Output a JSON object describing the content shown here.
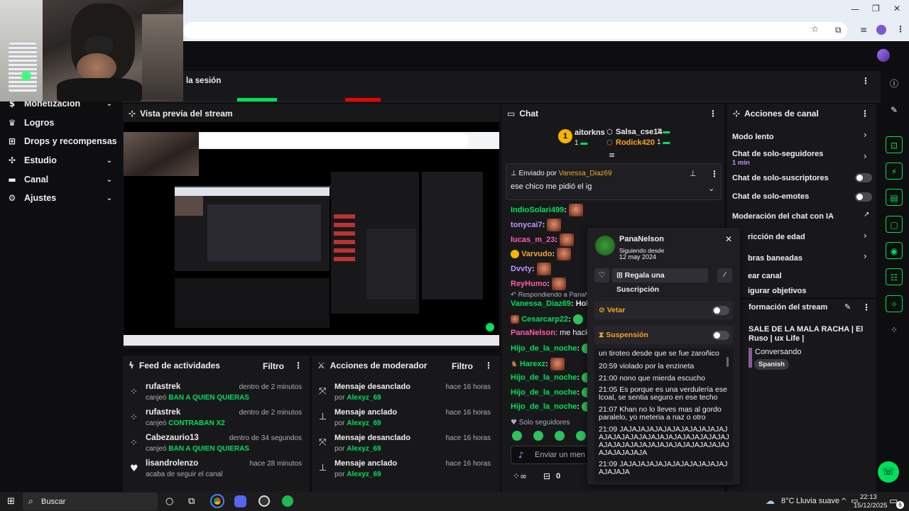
{
  "browser": {
    "minimize": "—",
    "restore": "❐",
    "close": "✕"
  },
  "stats": {
    "title_partial": "la sesión"
  },
  "sidebar": {
    "items": [
      {
        "label": "Monetización",
        "icon": "dollar-icon",
        "chevron": true
      },
      {
        "label": "Logros",
        "icon": "trophy-icon",
        "chevron": false
      },
      {
        "label": "Drops y recompensas",
        "icon": "gift-icon",
        "chevron": false
      },
      {
        "label": "Estudio",
        "icon": "studio-icon",
        "chevron": true
      },
      {
        "label": "Canal",
        "icon": "channel-icon",
        "chevron": true
      },
      {
        "label": "Ajustes",
        "icon": "gear-icon",
        "chevron": true
      }
    ]
  },
  "preview": {
    "title": "Vista previa del stream"
  },
  "activity": {
    "title": "Feed de actividades",
    "filter": "Filtro",
    "rows": [
      {
        "user": "rufastrek",
        "prefix": "canjeó",
        "reward": "BAN A QUIEN QUIERAS",
        "time": "dentro de 2 minutos"
      },
      {
        "user": "rufastrek",
        "prefix": "canjeó",
        "reward": "CONTRABAN X2",
        "time": "dentro de 2 minutos"
      },
      {
        "user": "Cabezaurio13",
        "prefix": "canjeó",
        "reward": "BAN A QUIEN QUIERAS",
        "time": "dentro de 34 segundos"
      },
      {
        "user": "lisandrolenzo",
        "prefix": "acaba de seguir el canal",
        "reward": "",
        "time": "hace 28 minutos"
      }
    ]
  },
  "modactions": {
    "title": "Acciones de moderador",
    "filter": "Filtro",
    "rows": [
      {
        "title": "Mensaje desanclado",
        "by": "por",
        "user": "Alexyz_69",
        "time": "hace 16 horas"
      },
      {
        "title": "Mensaje anclado",
        "by": "por",
        "user": "Alexyz_69",
        "time": "hace 16 horas"
      },
      {
        "title": "Mensaje desanclado",
        "by": "por",
        "user": "Alexyz_69",
        "time": "hace 16 horas"
      },
      {
        "title": "Mensaje anclado",
        "by": "por",
        "user": "Alexyz_69",
        "time": "hace 16 horas"
      }
    ]
  },
  "chat": {
    "title": "Chat",
    "leaders": [
      {
        "rank": "1",
        "name": "aitorkns",
        "count": "1"
      },
      {
        "name": "Salsa_cse14",
        "count": "1"
      },
      {
        "name": "Rodick420",
        "count": "1"
      }
    ],
    "pinned_label": "Enviado por",
    "pinned_user": "Vanessa_Diaz69",
    "pinned_text": "ese chico me pidió el ig",
    "lines": [
      {
        "name": "IndioSolari499",
        "text": ":",
        "cls": "green-name",
        "emote": "face"
      },
      {
        "name": "tonycai7",
        "text": ":",
        "cls": "purple-name",
        "emote": "face"
      },
      {
        "name": "lucas_m_23",
        "text": ":",
        "cls": "pink-name",
        "emote": "face"
      },
      {
        "name": "Varvudo",
        "text": ":",
        "cls": "green-name",
        "emote": "face"
      },
      {
        "name": "Dvvty",
        "text": ":",
        "cls": "purple-name",
        "emote": "face"
      },
      {
        "name": "ReyHumo",
        "text": ":",
        "cls": "pink-name",
        "emote": "face"
      },
      {
        "name": "Respondiendo a PanaN",
        "text": "",
        "cls": "reply",
        "emote": ""
      },
      {
        "name": "Vanessa_Diaz69",
        "text": ": Hola",
        "cls": "green-name",
        "emote": ""
      },
      {
        "name": "Cesarcarp22",
        "text": ":",
        "cls": "green-name",
        "emote": "green"
      },
      {
        "name": "PanaNelson",
        "text": ": me hackea",
        "cls": "pink-name",
        "emote": ""
      },
      {
        "name": "Hijo_de_la_noche",
        "text": ":",
        "cls": "green-name",
        "emote": "green"
      },
      {
        "name": "Harexz",
        "text": ":",
        "cls": "green-name",
        "emote": "face"
      },
      {
        "name": "Hijo_de_la_noche",
        "text": ":",
        "cls": "green-name",
        "emote": "green"
      },
      {
        "name": "Hijo_de_la_noche",
        "text": ":",
        "cls": "green-name",
        "emote": "green"
      },
      {
        "name": "Hijo_de_la_noche",
        "text": ":",
        "cls": "green-name",
        "emote": "green"
      }
    ],
    "followers_only": "Solo seguidores",
    "input_placeholder": "Enviar un men",
    "bits": "0"
  },
  "actions": {
    "title": "Acciones de canal",
    "slow_mode": "Modo lento",
    "followers_only": "Chat de solo-seguidores",
    "followers_dur": "1 min",
    "subs_only": "Chat de solo-suscriptores",
    "emotes_only": "Chat de solo-emotes",
    "ai_mod": "Moderación del chat con IA",
    "age": "ricción de edad",
    "banned": "bras baneadas",
    "raid": "ear canal",
    "goals": "igurar objetivos"
  },
  "streaminfo": {
    "title": "formación del stream",
    "stream_title": "SALE DE LA MALA RACHA | El Ruso | ux Life |",
    "category": "Conversando",
    "tag": "Spanish"
  },
  "popup": {
    "name": "PanaNelson",
    "following_label": "Siguiendo desde",
    "following_date": "12 may 2024",
    "gift": "Regala una Suscripción",
    "ban": "Vetar",
    "timeout": "Suspensión",
    "messages": [
      "un tiroteo desde que se fue zaroñico",
      "20:59 violado por la enzineta",
      "21:00 nono que mierda escucho",
      "21:05 Es porque es una verdulería ese lcoal, se sentia seguro en ese techo",
      "21:07 Khan no lo lleves mas al gordo paralelo, yo meteria a naz o otro",
      "21:09 JAJAJAJAJAJAJAJAJAJAJAJAJAJAJAJAJAJAJAJAJAJAJAJAJAJAJAJAJAJAJAJAJAJAJAJAJAJAJAJAJAJAJAJAJAJAJAJA",
      "21:09 JAJAJAJAJAJAJAJAJAJAJAJAJAJAJAJA"
    ]
  },
  "taskbar": {
    "search": "Buscar",
    "weather": "8°C",
    "weather_desc": "Lluvia suave",
    "time": "22:13",
    "date": "15/12/2025",
    "notif": "6"
  },
  "colors": {
    "accent": "#00e05a",
    "bg": "#0e0e10",
    "panel": "#18181b",
    "purple": "#bf94ff"
  }
}
